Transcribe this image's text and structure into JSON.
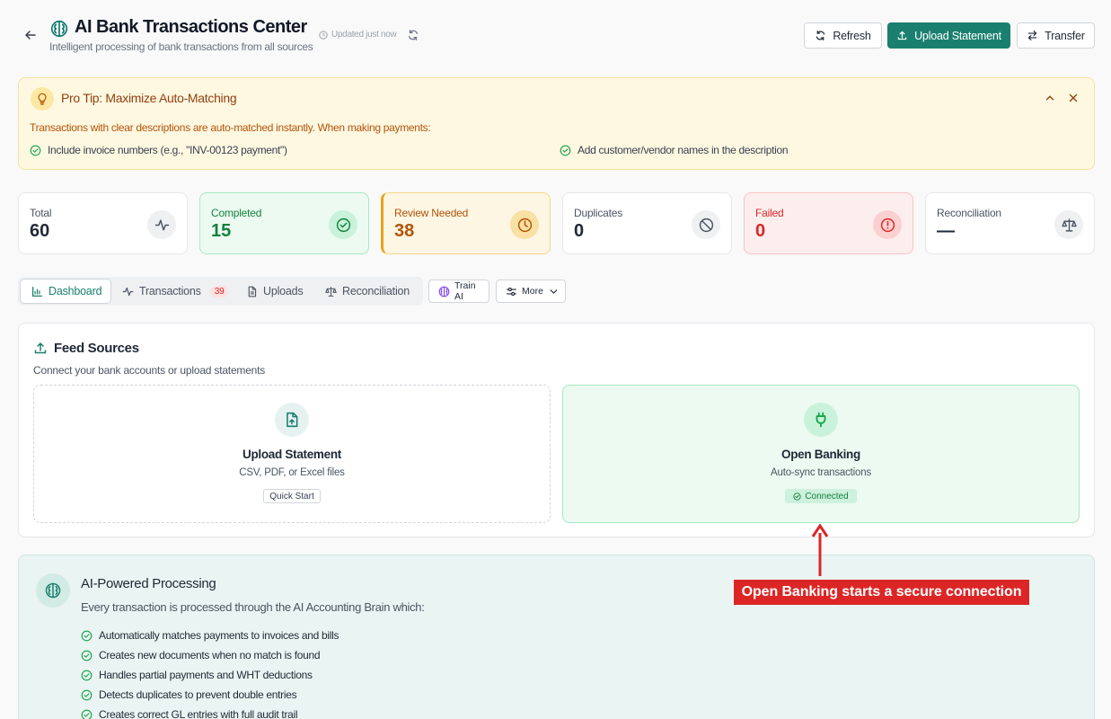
{
  "header": {
    "title": "AI Bank Transactions Center",
    "subtitle": "Intelligent processing of bank transactions from all sources",
    "updated": "Updated just now",
    "refresh_label": "Refresh",
    "upload_label": "Upload Statement",
    "transfer_label": "Transfer"
  },
  "tip": {
    "title": "Pro Tip: Maximize Auto-Matching",
    "text": "Transactions with clear descriptions are auto-matched instantly. When making payments:",
    "items": [
      "Include invoice numbers (e.g., \"INV-00123 payment\")",
      "Add customer/vendor names in the description"
    ]
  },
  "stats": [
    {
      "label": "Total",
      "value": "60"
    },
    {
      "label": "Completed",
      "value": "15"
    },
    {
      "label": "Review Needed",
      "value": "38"
    },
    {
      "label": "Duplicates",
      "value": "0"
    },
    {
      "label": "Failed",
      "value": "0"
    },
    {
      "label": "Reconciliation",
      "value": "—"
    }
  ],
  "tabs": [
    {
      "label": "Dashboard"
    },
    {
      "label": "Transactions",
      "badge": "39"
    },
    {
      "label": "Uploads"
    },
    {
      "label": "Reconciliation"
    }
  ],
  "actions": {
    "train_label": "Train AI",
    "more_label": "More"
  },
  "feed": {
    "title": "Feed Sources",
    "subtitle": "Connect your bank accounts or upload statements",
    "upload": {
      "title": "Upload Statement",
      "desc": "CSV, PDF, or Excel files",
      "tag": "Quick Start"
    },
    "open_banking": {
      "title": "Open Banking",
      "desc": "Auto-sync transactions",
      "tag": "Connected"
    }
  },
  "ai": {
    "title": "AI-Powered Processing",
    "subtitle": "Every transaction is processed through the AI Accounting Brain which:",
    "items": [
      "Automatically matches payments to invoices and bills",
      "Creates new documents when no match is found",
      "Handles partial payments and WHT deductions",
      "Detects duplicates to prevent double entries",
      "Creates correct GL entries with full audit trail"
    ]
  },
  "annotation": {
    "label": "Open Banking starts a secure connection",
    "color": "#dc2626"
  },
  "colors": {
    "primary": "#1a7f6e",
    "success": "#16a34a",
    "warning": "#b45309",
    "danger": "#dc2626"
  }
}
